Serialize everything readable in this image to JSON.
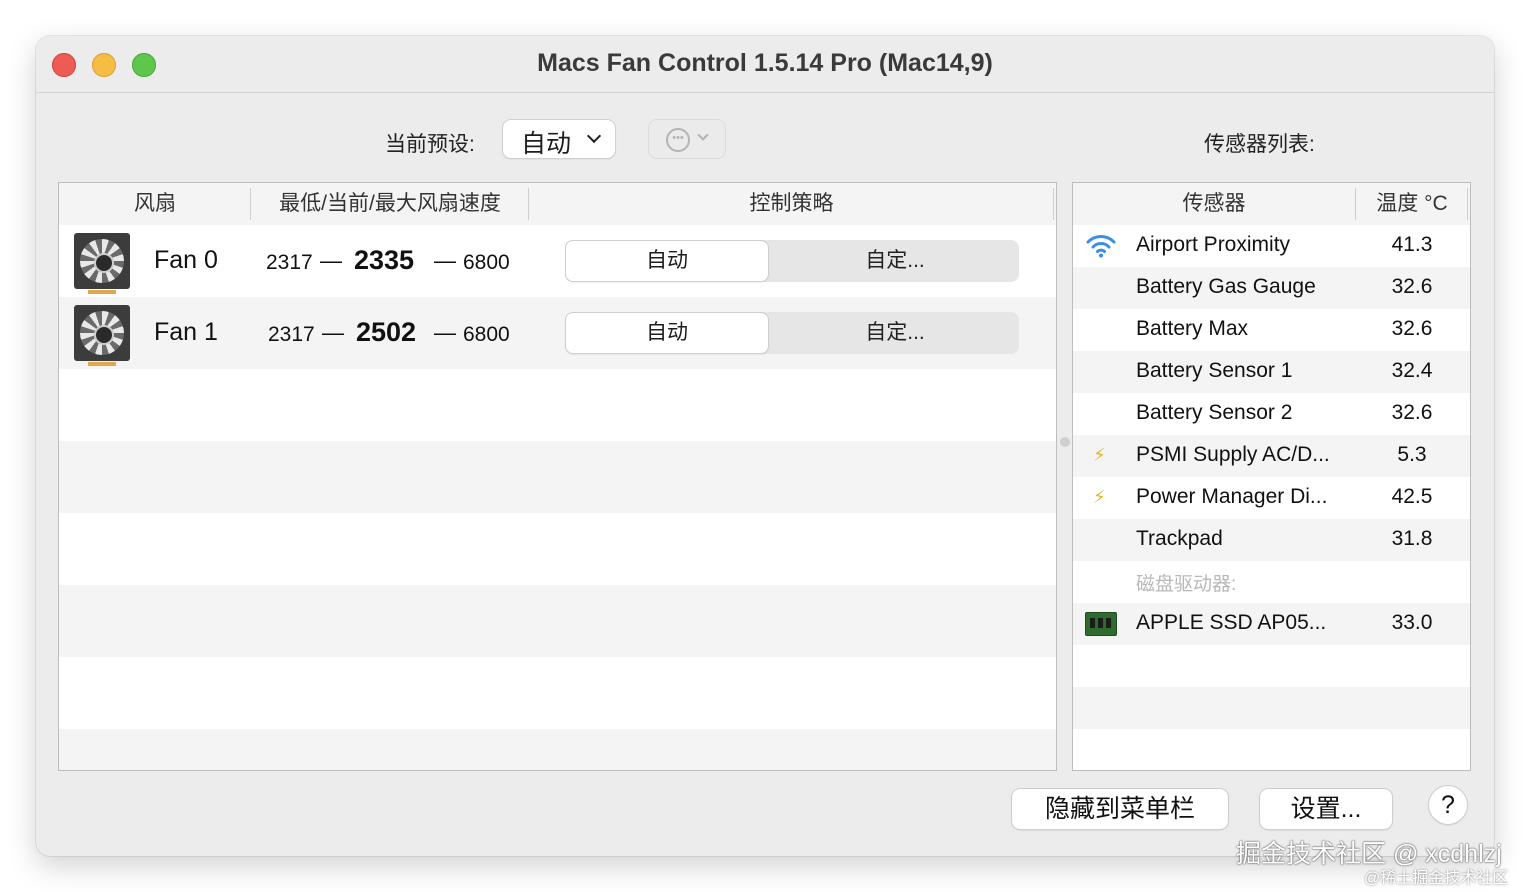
{
  "window": {
    "title": "Macs Fan Control 1.5.14 Pro (Mac14,9)"
  },
  "preset": {
    "label": "当前预设:",
    "value": "自动"
  },
  "sensors_label": "传感器列表:",
  "fans_table": {
    "headers": [
      "风扇",
      "最低/当前/最大风扇速度",
      "控制策略"
    ],
    "rows": [
      {
        "name": "Fan 0",
        "min": "2317",
        "current": "2335",
        "max": "6800",
        "dash": "—",
        "auto_label": "自动",
        "custom_label": "自定..."
      },
      {
        "name": "Fan 1",
        "min": "2317",
        "current": "2502",
        "max": "6800",
        "dash": "—",
        "auto_label": "自动",
        "custom_label": "自定..."
      }
    ]
  },
  "sensors_table": {
    "headers": [
      "传感器",
      "温度 °C"
    ],
    "rows": [
      {
        "icon": "wifi-icon",
        "name": "Airport Proximity",
        "value": "41.3"
      },
      {
        "icon": "",
        "name": "Battery Gas Gauge",
        "value": "32.6"
      },
      {
        "icon": "",
        "name": "Battery Max",
        "value": "32.6"
      },
      {
        "icon": "",
        "name": "Battery Sensor 1",
        "value": "32.4"
      },
      {
        "icon": "",
        "name": "Battery Sensor 2",
        "value": "32.6"
      },
      {
        "icon": "lightning-icon",
        "name": "PSMI Supply AC/D...",
        "value": "5.3"
      },
      {
        "icon": "lightning-icon",
        "name": "Power Manager Di...",
        "value": "42.5"
      },
      {
        "icon": "",
        "name": "Trackpad",
        "value": "31.8"
      }
    ],
    "group_label": "磁盘驱动器:",
    "disk_rows": [
      {
        "icon": "ssd-icon",
        "name": "APPLE SSD AP05...",
        "value": "33.0"
      }
    ]
  },
  "buttons": {
    "hide_menu": "隐藏到菜单栏",
    "settings": "设置...",
    "help": "?"
  },
  "watermark": {
    "main": "掘金技术社区 @ xcdhlzj",
    "sub": "@稀土掘金技术社区"
  }
}
